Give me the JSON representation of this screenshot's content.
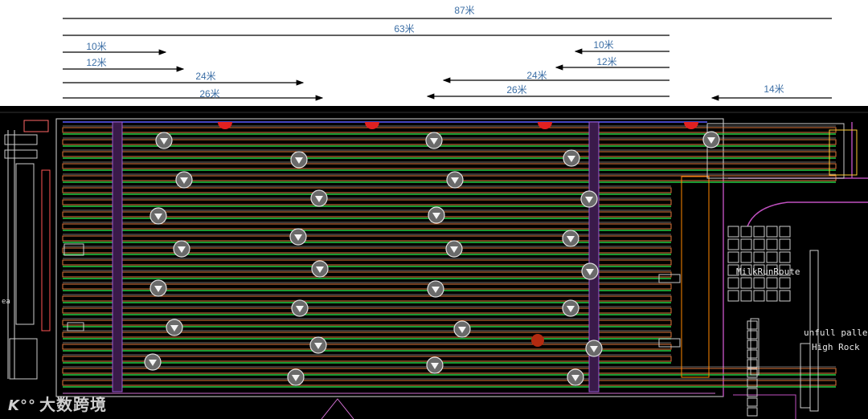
{
  "dimensions": [
    {
      "label": "87米",
      "dir": "both"
    },
    {
      "label": "63米",
      "dir": "both"
    },
    {
      "label": "10米",
      "dir": "right"
    },
    {
      "label": "12米",
      "dir": "right"
    },
    {
      "label": "24米",
      "dir": "right"
    },
    {
      "label": "26米",
      "dir": "right"
    },
    {
      "label": "10米",
      "dir": "left"
    },
    {
      "label": "12米",
      "dir": "left"
    },
    {
      "label": "24米",
      "dir": "left"
    },
    {
      "label": "26米",
      "dir": "left"
    },
    {
      "label": "14米",
      "dir": "left"
    }
  ],
  "labels": {
    "milkrun": "MilkRunRoute",
    "unfull": "unfull pallet",
    "highrock": "High Rock",
    "watermark": "大数跨境",
    "watermark_logo": "K°°"
  },
  "colors": {
    "dimension_text": "#3b6ea5",
    "rack_green": "#22cc44",
    "rack_orange": "#e0783c",
    "aisle_purple": "#9b59d6",
    "marker_red": "#e02020"
  }
}
